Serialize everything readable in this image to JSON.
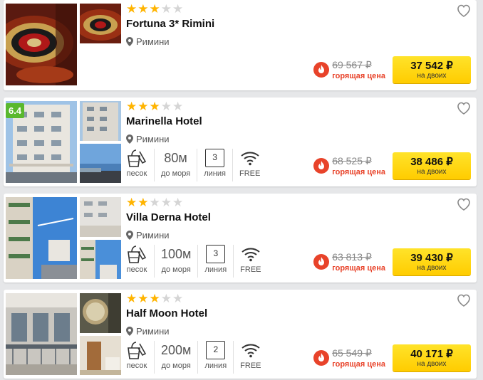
{
  "hotels": [
    {
      "name": "Fortuna 3* Rimini",
      "stars": 3,
      "max_stars": 5,
      "location": "Римини",
      "old_price": "69 567 ₽",
      "hot_label": "горящая цена",
      "price": "37 542 ₽",
      "price_note": "на двоих",
      "rating": null,
      "amenities": null
    },
    {
      "name": "Marinella Hotel",
      "stars": 3,
      "max_stars": 5,
      "location": "Римини",
      "old_price": "68 525 ₽",
      "hot_label": "горящая цена",
      "price": "38 486 ₽",
      "price_note": "на двоих",
      "rating": "6.4",
      "amenities": {
        "beach": "песок",
        "distance": "80м",
        "distance_label": "до моря",
        "line": "3",
        "line_label": "линия",
        "wifi": "FREE"
      }
    },
    {
      "name": "Villa Derna Hotel",
      "stars": 2,
      "max_stars": 5,
      "location": "Римини",
      "old_price": "63 813 ₽",
      "hot_label": "горящая цена",
      "price": "39 430 ₽",
      "price_note": "на двоих",
      "rating": null,
      "amenities": {
        "beach": "песок",
        "distance": "100м",
        "distance_label": "до моря",
        "line": "3",
        "line_label": "линия",
        "wifi": "FREE"
      }
    },
    {
      "name": "Half Moon Hotel",
      "stars": 3,
      "max_stars": 5,
      "location": "Римини",
      "old_price": "65 549 ₽",
      "hot_label": "горящая цена",
      "price": "40 171 ₽",
      "price_note": "на двоих",
      "rating": null,
      "amenities": {
        "beach": "песок",
        "distance": "200м",
        "distance_label": "до моря",
        "line": "2",
        "line_label": "линия",
        "wifi": "FREE"
      }
    }
  ],
  "colors": {
    "star_on": "#ffb400",
    "star_off": "#d5d5d5",
    "price_button": "#ffd400",
    "hot": "#e8432a",
    "rating_badge": "#5ab82e"
  },
  "icons": {
    "favorite": "heart-icon",
    "location": "map-pin-icon",
    "hot": "fire-icon",
    "beach": "beach-bucket-icon",
    "wifi": "wifi-icon"
  }
}
